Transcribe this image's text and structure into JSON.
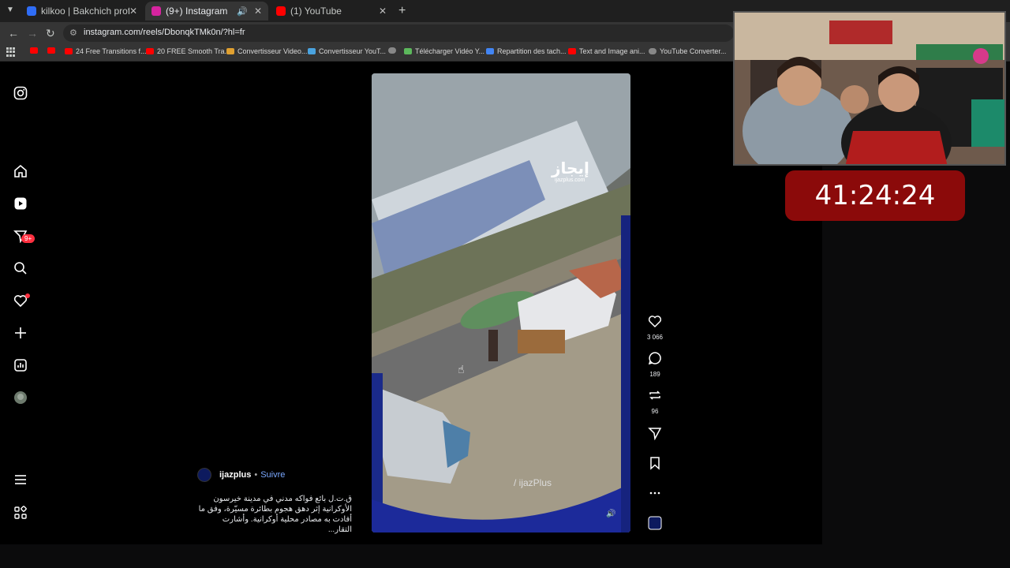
{
  "browser": {
    "tabs": [
      {
        "title": "kilkoo | Bakchich profile | Bakchich",
        "favicon_color": "#2f6df6"
      },
      {
        "title": "(9+) Instagram",
        "favicon_color": "#d6249f"
      },
      {
        "title": "(1) YouTube",
        "favicon_color": "#ff0000"
      }
    ],
    "url": "instagram.com/reels/DbonqkTMk0n/?hl=fr",
    "bookmarks": [
      "24 Free Transitions f...",
      "20 FREE Smooth Tra...",
      "Convertisseur Video...",
      "Convertisseur YouT...",
      "Télécharger Vidéo Y...",
      "Repartition des tach...",
      "Text and Image ani...",
      "YouTube Converter..."
    ]
  },
  "instagram": {
    "nav_items": [
      "instagram-logo-icon",
      "home-icon",
      "reels-icon",
      "messages-icon",
      "search-icon",
      "notifications-icon",
      "create-icon",
      "dashboard-icon",
      "profile-avatar",
      "more-menu-icon",
      "meta-apps-icon"
    ],
    "messages_badge": "9+",
    "reel": {
      "watermark_logo": "إيجاز",
      "watermark_site": "ijazplus.com",
      "watermark_handle": "/ ijazPlus",
      "likes": "3 066",
      "comments": "189",
      "reposts": "96",
      "author": "ijazplus",
      "follow_label": "Suivre",
      "caption": "ق.ت.ل بائع فواكه مدني في مدينة خيرسون الأوكرانية إثر دهق هجوم بطائرة مسيّرة، وفق ما أفادت به مصادر محلية أوكرانية. وأشارت التقار..."
    }
  },
  "overlay": {
    "timer": "41:24:24"
  }
}
